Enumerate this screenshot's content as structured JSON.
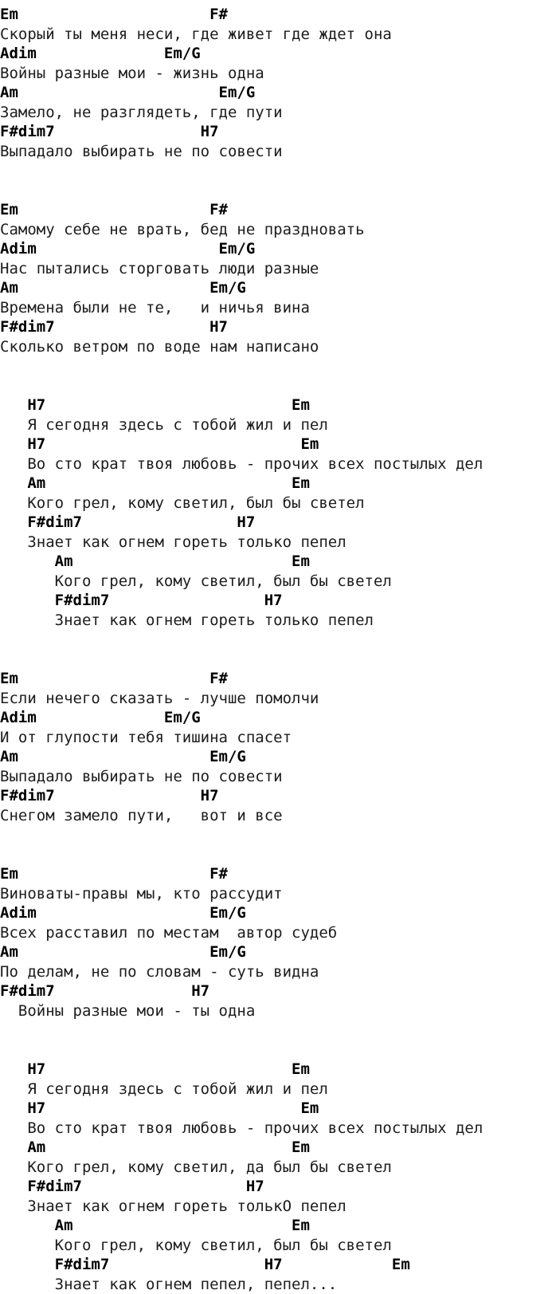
{
  "document": {
    "kind": "song-chord-sheet",
    "language": "ru",
    "text_color": "#1c1c1c",
    "chord_color": "#000000",
    "background_color": "#ffffff",
    "chords_used": [
      "Em",
      "F#",
      "Adim",
      "Em/G",
      "Am",
      "F#dim7",
      "H7"
    ],
    "lines": [
      {
        "type": "chord",
        "text": "Em                     F#"
      },
      {
        "type": "lyric",
        "text": "Скорый ты меня неси, где живет где ждет она"
      },
      {
        "type": "chord",
        "text": "Adim              Em/G"
      },
      {
        "type": "lyric",
        "text": "Войны разные мои - жизнь одна"
      },
      {
        "type": "chord",
        "text": "Am                      Em/G"
      },
      {
        "type": "lyric",
        "text": "Замело, не разглядеть, где пути"
      },
      {
        "type": "chord",
        "text": "F#dim7                H7"
      },
      {
        "type": "lyric",
        "text": "Выпадало выбирать не по совести"
      },
      {
        "type": "blank",
        "text": ""
      },
      {
        "type": "blank",
        "text": ""
      },
      {
        "type": "chord",
        "text": "Em                     F#"
      },
      {
        "type": "lyric",
        "text": "Самому себе не врать, бед не праздновать"
      },
      {
        "type": "chord",
        "text": "Adim                    Em/G"
      },
      {
        "type": "lyric",
        "text": "Нас пытались сторговать люди разные"
      },
      {
        "type": "chord",
        "text": "Am                     Em/G"
      },
      {
        "type": "lyric",
        "text": "Времена были не те,   и ничья вина"
      },
      {
        "type": "chord",
        "text": "F#dim7                 H7"
      },
      {
        "type": "lyric",
        "text": "Сколько ветром по воде нам написано"
      },
      {
        "type": "blank",
        "text": ""
      },
      {
        "type": "blank",
        "text": ""
      },
      {
        "type": "chord",
        "text": "   H7                           Em"
      },
      {
        "type": "lyric",
        "text": "   Я сегодня здесь с тобой жил и пел"
      },
      {
        "type": "chord",
        "text": "   H7                            Em"
      },
      {
        "type": "lyric",
        "text": "   Во сто крат твоя любовь - прочих всех постылых дел"
      },
      {
        "type": "chord",
        "text": "   Am                           Em"
      },
      {
        "type": "lyric",
        "text": "   Кого грел, кому светил, был бы светел"
      },
      {
        "type": "chord",
        "text": "   F#dim7                 H7"
      },
      {
        "type": "lyric",
        "text": "   Знает как огнем гореть только пепел"
      },
      {
        "type": "chord",
        "text": "      Am                        Em"
      },
      {
        "type": "lyric",
        "text": "      Кого грел, кому светил, был бы светел"
      },
      {
        "type": "chord",
        "text": "      F#dim7                 H7"
      },
      {
        "type": "lyric",
        "text": "      Знает как огнем гореть только пепел"
      },
      {
        "type": "blank",
        "text": ""
      },
      {
        "type": "blank",
        "text": ""
      },
      {
        "type": "chord",
        "text": "Em                     F#"
      },
      {
        "type": "lyric",
        "text": "Если нечего сказать - лучше помолчи"
      },
      {
        "type": "chord",
        "text": "Adim              Em/G"
      },
      {
        "type": "lyric",
        "text": "И от глупости тебя тишина спасет"
      },
      {
        "type": "chord",
        "text": "Am                     Em/G"
      },
      {
        "type": "lyric",
        "text": "Выпадало выбирать не по совести"
      },
      {
        "type": "chord",
        "text": "F#dim7                H7"
      },
      {
        "type": "lyric",
        "text": "Снегом замело пути,   вот и все"
      },
      {
        "type": "blank",
        "text": ""
      },
      {
        "type": "blank",
        "text": ""
      },
      {
        "type": "chord",
        "text": "Em                     F#"
      },
      {
        "type": "lyric",
        "text": "Виноваты-правы мы, кто рассудит"
      },
      {
        "type": "chord",
        "text": "Adim                   Em/G"
      },
      {
        "type": "lyric",
        "text": "Всех расставил по местам  автор судеб"
      },
      {
        "type": "chord",
        "text": "Am                     Em/G"
      },
      {
        "type": "lyric",
        "text": "По делам, не по словам - суть видна"
      },
      {
        "type": "chord",
        "text": "F#dim7               H7"
      },
      {
        "type": "lyric",
        "text": "  Войны разные мои - ты одна"
      },
      {
        "type": "blank",
        "text": ""
      },
      {
        "type": "blank",
        "text": ""
      },
      {
        "type": "chord",
        "text": "   H7                           Em"
      },
      {
        "type": "lyric",
        "text": "   Я сегодня здесь с тобой жил и пел"
      },
      {
        "type": "chord",
        "text": "   H7                            Em"
      },
      {
        "type": "lyric",
        "text": "   Во сто крат твоя любовь - прочих всех постылых дел"
      },
      {
        "type": "chord",
        "text": "   Am                           Em"
      },
      {
        "type": "lyric",
        "text": "   Кого грел, кому светил, да был бы светел"
      },
      {
        "type": "chord",
        "text": "   F#dim7                  H7"
      },
      {
        "type": "lyric",
        "text": "   Знает как огнем гореть толькО пепел"
      },
      {
        "type": "chord",
        "text": "      Am                        Em"
      },
      {
        "type": "lyric",
        "text": "      Кого грел, кому светил, был бы светел"
      },
      {
        "type": "chord",
        "text": "      F#dim7                 H7            Em"
      },
      {
        "type": "lyric",
        "text": "      Знает как огнем пепел, пепел..."
      }
    ]
  }
}
